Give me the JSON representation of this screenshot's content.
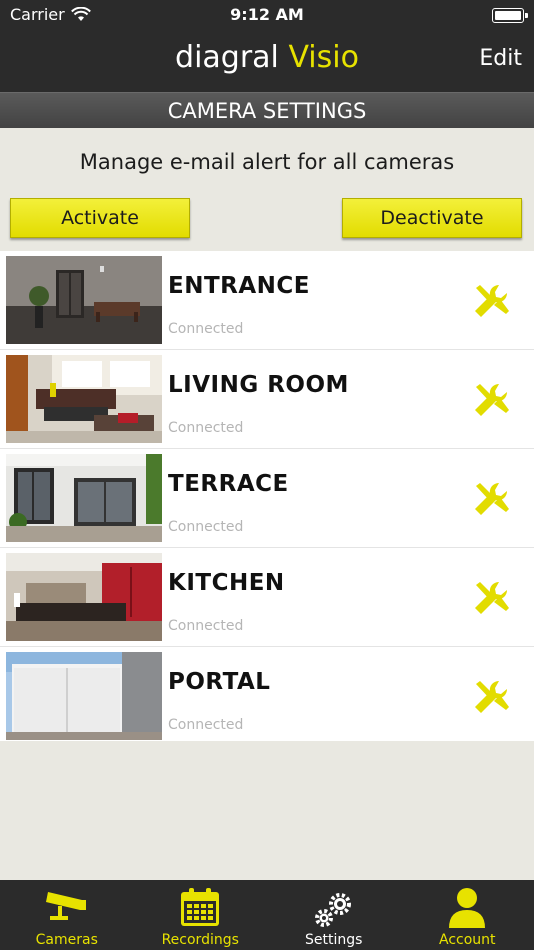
{
  "status_bar": {
    "carrier": "Carrier",
    "time": "9:12 AM"
  },
  "nav": {
    "brand_main": "diagral",
    "brand_accent": "Visio",
    "edit_label": "Edit"
  },
  "section_header": "CAMERA SETTINGS",
  "email_alert": {
    "text": "Manage e-mail alert for all cameras",
    "activate_label": "Activate",
    "deactivate_label": "Deactivate"
  },
  "cameras": [
    {
      "name": "ENTRANCE",
      "status": "Connected"
    },
    {
      "name": "LIVING ROOM",
      "status": "Connected"
    },
    {
      "name": "TERRACE",
      "status": "Connected"
    },
    {
      "name": "KITCHEN",
      "status": "Connected"
    },
    {
      "name": "PORTAL",
      "status": "Connected"
    }
  ],
  "tabs": [
    {
      "label": "Cameras",
      "icon": "camera-icon"
    },
    {
      "label": "Recordings",
      "icon": "calendar-icon"
    },
    {
      "label": "Settings",
      "icon": "gears-icon",
      "active": true
    },
    {
      "label": "Account",
      "icon": "user-icon"
    }
  ],
  "colors": {
    "accent": "#e7e200",
    "bar": "#2b2b2b",
    "background": "#e9e8e1"
  }
}
